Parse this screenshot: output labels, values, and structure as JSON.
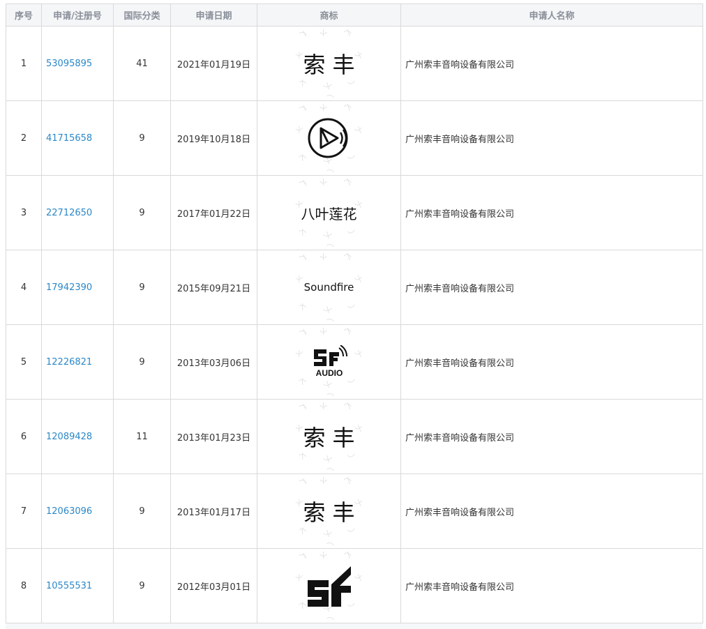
{
  "headers": {
    "index": "序号",
    "reg_no": "申请/注册号",
    "intl_class": "国际分类",
    "apply_date": "申请日期",
    "trademark": "商标",
    "applicant": "申请人名称"
  },
  "rows": [
    {
      "index": "1",
      "reg_no": "53095895",
      "intl_class": "41",
      "apply_date": "2021年01月19日",
      "mark_text": "索丰",
      "mark_icon": "",
      "applicant": "广州索丰音响设备有限公司"
    },
    {
      "index": "2",
      "reg_no": "41715658",
      "intl_class": "9",
      "apply_date": "2019年10月18日",
      "mark_text": "",
      "mark_icon": "circle-play-sound-logo-icon",
      "applicant": "广州索丰音响设备有限公司"
    },
    {
      "index": "3",
      "reg_no": "22712650",
      "intl_class": "9",
      "apply_date": "2017年01月22日",
      "mark_text": "八叶莲花",
      "mark_icon": "",
      "applicant": "广州索丰音响设备有限公司"
    },
    {
      "index": "4",
      "reg_no": "17942390",
      "intl_class": "9",
      "apply_date": "2015年09月21日",
      "mark_text": "Soundfire",
      "mark_icon": "",
      "applicant": "广州索丰音响设备有限公司"
    },
    {
      "index": "5",
      "reg_no": "12226821",
      "intl_class": "9",
      "apply_date": "2013年03月06日",
      "mark_text": "AUDIO",
      "mark_icon": "sf-audio-logo-icon",
      "applicant": "广州索丰音响设备有限公司"
    },
    {
      "index": "6",
      "reg_no": "12089428",
      "intl_class": "11",
      "apply_date": "2013年01月23日",
      "mark_text": "索丰",
      "mark_icon": "",
      "applicant": "广州索丰音响设备有限公司"
    },
    {
      "index": "7",
      "reg_no": "12063096",
      "intl_class": "9",
      "apply_date": "2013年01月17日",
      "mark_text": "索丰",
      "mark_icon": "",
      "applicant": "广州索丰音响设备有限公司"
    },
    {
      "index": "8",
      "reg_no": "10555531",
      "intl_class": "9",
      "apply_date": "2012年03月01日",
      "mark_text": "",
      "mark_icon": "sf-logo-icon",
      "applicant": "广州索丰音响设备有限公司"
    }
  ],
  "colors": {
    "link": "#2a88c8",
    "header_bg": "#f5f6f8",
    "border": "#d9d9d9"
  }
}
